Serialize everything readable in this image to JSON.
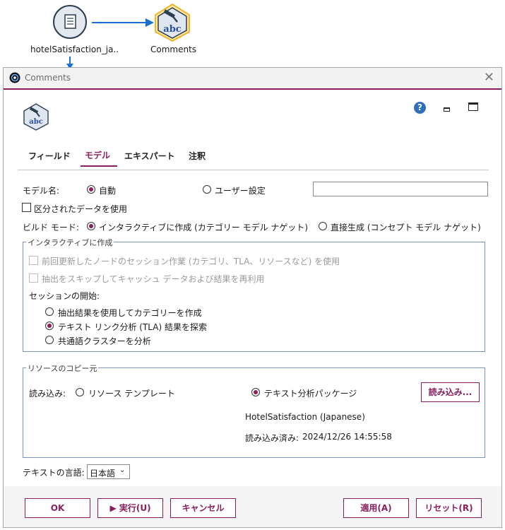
{
  "canvas": {
    "source_node_label": "hotelSatisfaction_ja..",
    "target_node_label": "Comments",
    "node_icon_text": "abc"
  },
  "dialog": {
    "title": "Comments",
    "tabs": [
      "フィールド",
      "モデル",
      "エキスパート",
      "注釈"
    ],
    "active_tab": "モデル",
    "model_name_label": "モデル名:",
    "model_name_auto": "自動",
    "model_name_custom": "ユーザー設定",
    "model_name_value": "",
    "partition_label": "区分されたデータを使用",
    "build_mode_label": "ビルド モード:",
    "build_interactive": "インタラクティブに作成 (カテゴリー モデル ナゲット)",
    "build_direct": "直接生成 (コンセプト モデル ナゲット)",
    "interactive_group": {
      "title": "インタラクティブに作成",
      "option1": "前回更新したノードのセッション作業 (カテゴリ、TLA、リソースなど) を使用",
      "option2": "抽出をスキップしてキャッシュ データおよび結果を再利用",
      "session_start_label": "セッションの開始:",
      "session_options": [
        "抽出結果を使用してカテゴリーを作成",
        "テキスト リンク分析 (TLA) 結果を探索",
        "共通語クラスターを分析"
      ]
    },
    "resource_group": {
      "title": "リソースのコピー元",
      "load_label": "読み込み:",
      "template_option": "リソース テンプレート",
      "package_option": "テキスト分析パッケージ",
      "load_button": "読み込み...",
      "package_name": "HotelSatisfaction (Japanese)",
      "loaded_label": "読み込み済み:",
      "loaded_time": "2024/12/26 14:55:58"
    },
    "language_label": "テキストの言語:",
    "language_value": "日本語",
    "buttons": {
      "ok": "OK",
      "run": "実行(U)",
      "cancel": "キャンセル",
      "apply": "適用(A)",
      "reset": "リセット(R)"
    },
    "help_glyph": "?"
  },
  "colors": {
    "accent": "#8a1f5e",
    "help_blue": "#2f6fc0",
    "node_gold": "#f0b429",
    "arrow_blue": "#1c6fd1"
  }
}
